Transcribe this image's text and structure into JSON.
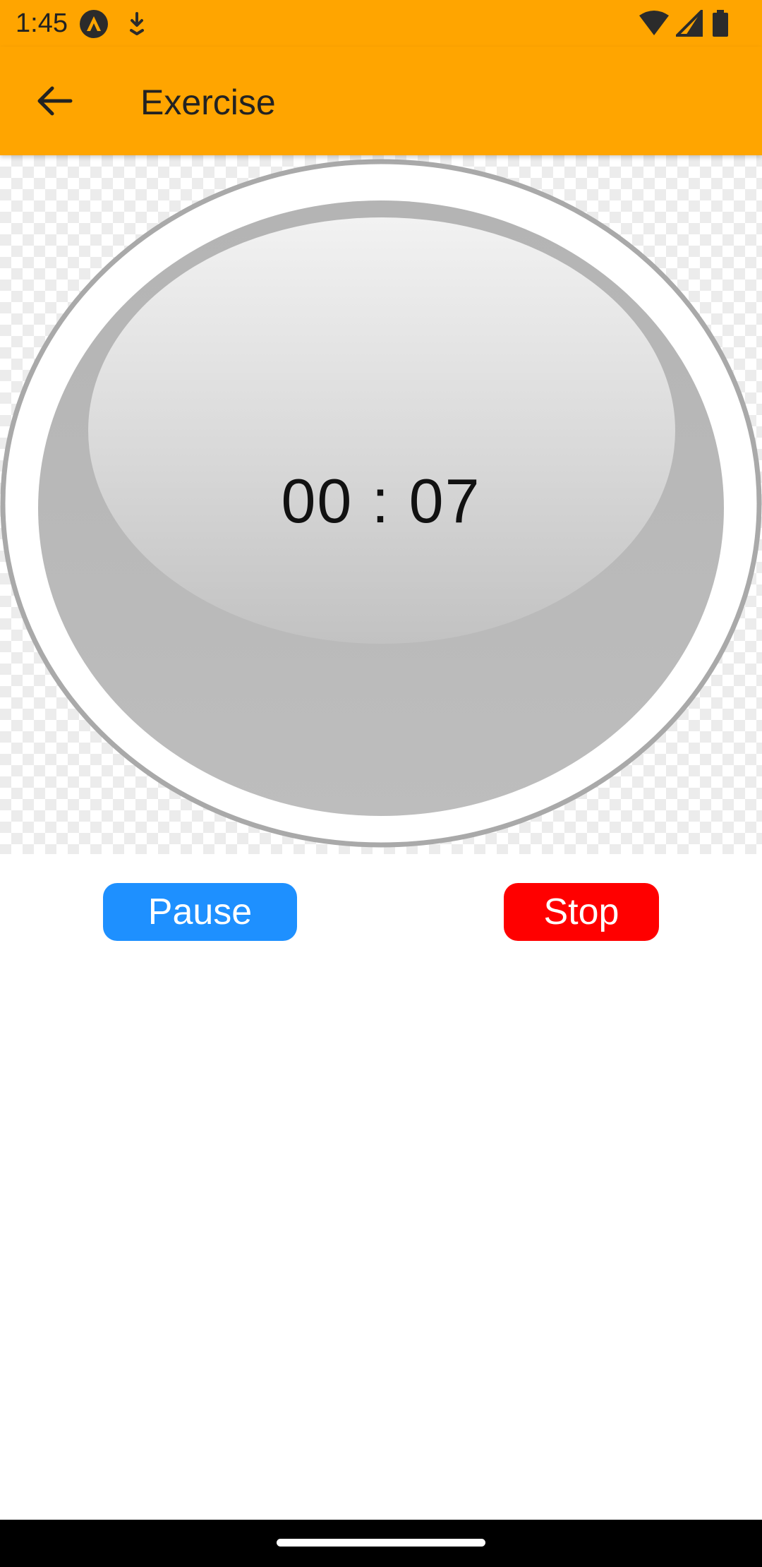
{
  "status_bar": {
    "time": "1:45",
    "icons": [
      "app-notification-icon",
      "download-notification-icon",
      "wifi-icon",
      "cellular-signal-icon",
      "battery-icon"
    ]
  },
  "app_bar": {
    "title": "Exercise",
    "back_icon": "arrow-back-icon",
    "background_color": "#FFA500"
  },
  "timer": {
    "display": "00 : 07"
  },
  "controls": {
    "pause_label": "Pause",
    "pause_color": "#1E90FF",
    "stop_label": "Stop",
    "stop_color": "#FF0000"
  },
  "navigation": {
    "home_handle": "gesture-home-handle"
  }
}
